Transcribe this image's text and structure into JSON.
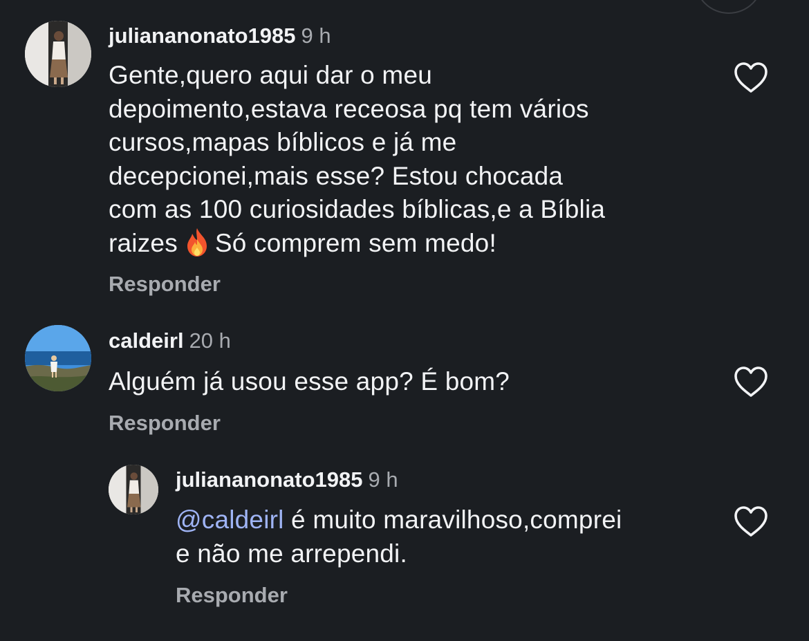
{
  "comments": [
    {
      "username": "juliananonato1985",
      "time": "9 h",
      "lines": [
        "Gente,quero aqui dar o meu",
        "depoimento,estava receosa pq tem vários",
        "cursos,mapas bíblicos e já me",
        "decepcionei,mais esse? Estou chocada",
        "com as 100 curiosidades bíblicas,e a Bíblia"
      ],
      "last_line_pre": "raizes",
      "emoji": "🔥",
      "last_line_post": "Só comprem sem medo!",
      "reply_label": "Responder",
      "avatar_icon": "person-photo-avatar",
      "like_icon": "heart-outline-icon"
    },
    {
      "username": "caldeirl",
      "time": "20 h",
      "lines": [
        "Alguém já usou esse app? É bom?"
      ],
      "reply_label": "Responder",
      "avatar_icon": "beach-photo-avatar",
      "like_icon": "heart-outline-icon"
    },
    {
      "username": "juliananonato1985",
      "time": "9 h",
      "mention": "@caldeirl",
      "line1_rest": " é muito maravilhoso,comprei",
      "line2": "e não me arrependi.",
      "reply_label": "Responder",
      "avatar_icon": "person-photo-avatar",
      "like_icon": "heart-outline-icon"
    }
  ],
  "colors": {
    "background": "#1b1e22",
    "text": "#f2f3f5",
    "secondary": "#a8abb0",
    "mention": "#9fb4f5"
  }
}
